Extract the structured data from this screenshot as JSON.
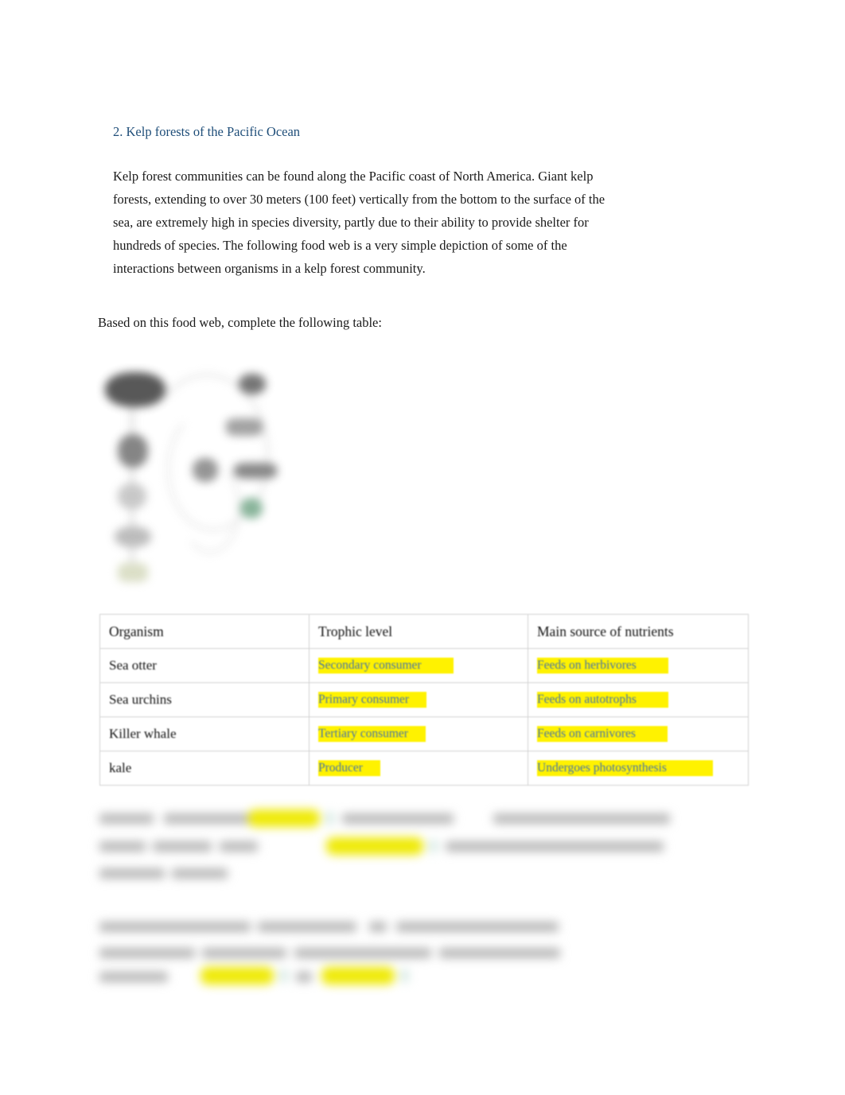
{
  "document": {
    "section_heading": "2. Kelp forests of the Pacific Ocean",
    "intro_paragraph": "Kelp forest communities can be found along the Pacific coast of North America. Giant kelp forests, extending to over 30 meters (100 feet) vertically from the bottom to the surface of the sea, are extremely high in species diversity, partly due to their ability to provide shelter for hundreds of species. The following food web is a very simple depiction of some of the interactions between organisms in a kelp forest community.",
    "prompt_line": "Based on this food web, complete the following table:"
  },
  "figure": {
    "name": "kelp-forest-food-web-diagram",
    "state": "blurred"
  },
  "table": {
    "headers": [
      "Organism",
      "Trophic level",
      "Main source of nutrients"
    ],
    "rows": [
      {
        "organism": "Sea otter",
        "trophic_level": "Secondary consumer",
        "nutrient_source": "Feeds on herbivores"
      },
      {
        "organism": "Sea urchins",
        "trophic_level": "Primary consumer",
        "nutrient_source": "Feeds on autotrophs"
      },
      {
        "organism": "Killer whale",
        "trophic_level": "Tertiary consumer",
        "nutrient_source": "Feeds on carnivores"
      },
      {
        "organism": "kale",
        "trophic_level": "Producer",
        "nutrient_source": "Undergoes photosynthesis"
      }
    ]
  },
  "redacted_blocks": [
    {
      "name": "redacted-paragraph-upper",
      "state": "blurred",
      "lines": 3
    },
    {
      "name": "redacted-paragraph-lower",
      "state": "blurred",
      "lines": 3
    }
  ],
  "colors": {
    "heading": "#1F4E79",
    "answer_text": "#4472A8",
    "highlight": "#FFF200",
    "body_text": "#1a1a1a",
    "table_border": "#d2d2d2",
    "page_background": "#ffffff"
  }
}
